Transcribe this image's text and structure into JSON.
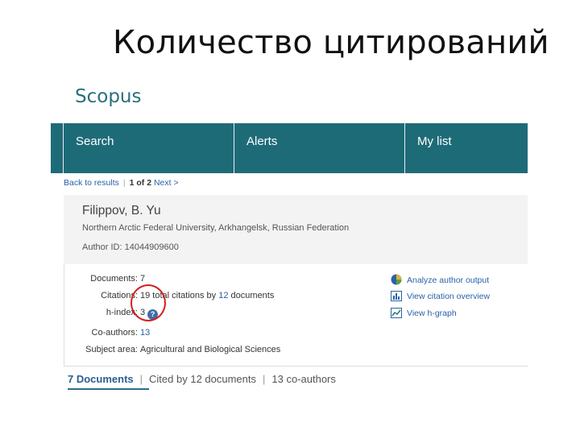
{
  "slide": {
    "title": "Количество цитирований"
  },
  "brand": {
    "name": "Scopus",
    "color": "#2b6f7c"
  },
  "nav": {
    "background": "#1e6b78",
    "tabs": [
      {
        "label": "Search"
      },
      {
        "label": "Alerts"
      },
      {
        "label": "My list"
      }
    ]
  },
  "breadcrumb": {
    "back": "Back to results",
    "position": "1 of 2",
    "next": "Next >"
  },
  "author": {
    "name": "Filippov, B. Yu",
    "affiliation": "Northern Arctic Federal University, Arkhangelsk, Russian Federation",
    "id_label": "Author ID:",
    "id_value": "14044909600"
  },
  "metrics": {
    "documents": {
      "label": "Documents:",
      "value": "7"
    },
    "citations": {
      "label": "Citations:",
      "count": "19 total citations by",
      "docs_link": "12",
      "docs_suffix": "documents"
    },
    "h_index": {
      "label": "h-index:",
      "value": "3",
      "help": "?"
    },
    "coauthors": {
      "label": "Co-authors:",
      "value": "13"
    },
    "subject": {
      "label": "Subject area:",
      "value": "Agricultural and Biological Sciences"
    }
  },
  "actions": [
    {
      "label": "Analyze author output",
      "icon": "pie-chart-icon"
    },
    {
      "label": "View citation overview",
      "icon": "bar-chart-icon"
    },
    {
      "label": "View h-graph",
      "icon": "line-graph-icon"
    }
  ],
  "tabs": {
    "documents": "7 Documents",
    "cited_by": "Cited by 12 documents",
    "coauthors": "13 co-authors"
  },
  "annotation": {
    "color": "#d32020"
  }
}
